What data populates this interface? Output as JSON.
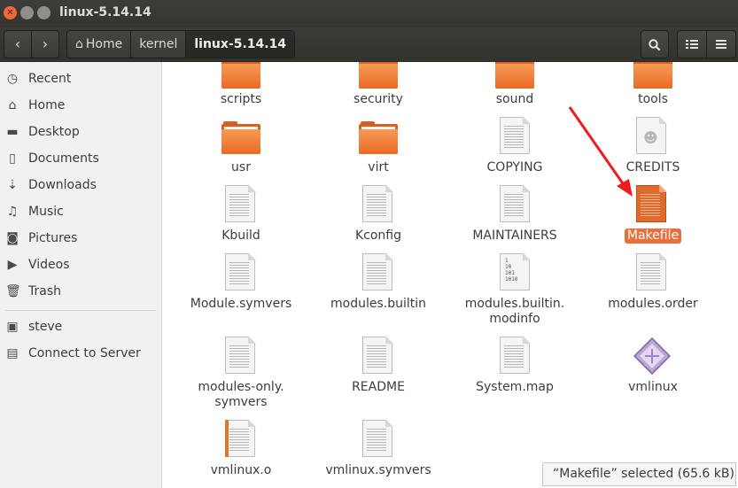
{
  "window": {
    "title": "linux-5.14.14"
  },
  "toolbar": {
    "back_icon": "chevron-left-icon",
    "forward_icon": "chevron-right-icon",
    "breadcrumbs": [
      "Home",
      "kernel",
      "linux-5.14.14"
    ],
    "search_icon": "search-icon",
    "view_icons": [
      "list-view-icon",
      "menu-icon"
    ]
  },
  "sidebar": {
    "places": [
      {
        "label": "Recent",
        "icon": "clock-icon"
      },
      {
        "label": "Home",
        "icon": "home-icon"
      },
      {
        "label": "Desktop",
        "icon": "folder-icon"
      },
      {
        "label": "Documents",
        "icon": "document-icon"
      },
      {
        "label": "Downloads",
        "icon": "download-icon"
      },
      {
        "label": "Music",
        "icon": "music-icon"
      },
      {
        "label": "Pictures",
        "icon": "camera-icon"
      },
      {
        "label": "Videos",
        "icon": "video-icon"
      },
      {
        "label": "Trash",
        "icon": "trash-icon"
      }
    ],
    "devices": [
      {
        "label": "steve",
        "icon": "drive-icon"
      },
      {
        "label": "Connect to Server",
        "icon": "server-icon"
      }
    ]
  },
  "files": [
    {
      "name": "scripts",
      "type": "folder"
    },
    {
      "name": "security",
      "type": "folder"
    },
    {
      "name": "sound",
      "type": "folder"
    },
    {
      "name": "tools",
      "type": "folder"
    },
    {
      "name": "usr",
      "type": "folder"
    },
    {
      "name": "virt",
      "type": "folder"
    },
    {
      "name": "COPYING",
      "type": "text"
    },
    {
      "name": "CREDITS",
      "type": "contact"
    },
    {
      "name": "Kbuild",
      "type": "text"
    },
    {
      "name": "Kconfig",
      "type": "text"
    },
    {
      "name": "MAINTAINERS",
      "type": "text"
    },
    {
      "name": "Makefile",
      "type": "makefile",
      "selected": true
    },
    {
      "name": "Module.symvers",
      "type": "text"
    },
    {
      "name": "modules.builtin",
      "type": "text"
    },
    {
      "name": "modules.builtin.\nmodinfo",
      "type": "binary"
    },
    {
      "name": "modules.order",
      "type": "text"
    },
    {
      "name": "modules-only.\nsymvers",
      "type": "text"
    },
    {
      "name": "README",
      "type": "text"
    },
    {
      "name": "System.map",
      "type": "text"
    },
    {
      "name": "vmlinux",
      "type": "executable"
    },
    {
      "name": "vmlinux.o",
      "type": "object"
    },
    {
      "name": "vmlinux.symvers",
      "type": "text"
    }
  ],
  "binary_icon_text": "1\n10\n101\n1010",
  "status_text": "“Makefile” selected  (65.6 kB)",
  "colors": {
    "selection": "#e8703a",
    "annotation_arrow": "#ee1c1c"
  }
}
